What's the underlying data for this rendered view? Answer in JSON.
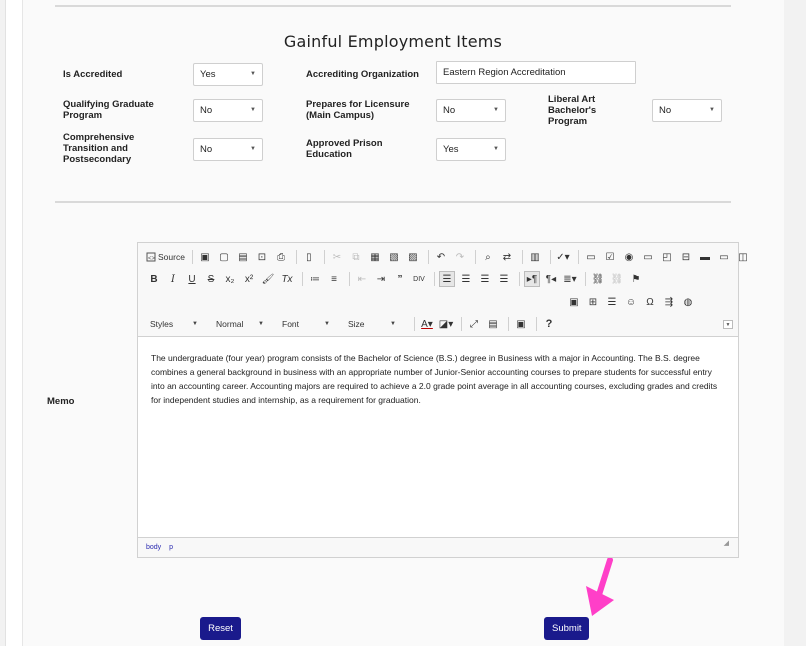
{
  "section": {
    "title": "Gainful Employment Items"
  },
  "fields": {
    "is_accredited": {
      "label": "Is Accredited",
      "value": "Yes"
    },
    "accrediting_org": {
      "label": "Accrediting Organization",
      "value": "Eastern Region Accreditation"
    },
    "qualifying_grad": {
      "label": "Qualifying Graduate Program",
      "value": "No"
    },
    "prepares_licensure": {
      "label": "Prepares for Licensure (Main Campus)",
      "value": "No"
    },
    "liberal_art": {
      "label": "Liberal Art Bachelor's Program",
      "value": "No"
    },
    "comprehensive": {
      "label": "Comprehensive Transition and Postsecondary",
      "value": "No"
    },
    "prison_edu": {
      "label": "Approved Prison Education",
      "value": "Yes"
    }
  },
  "memo": {
    "label": "Memo",
    "source_label": "Source",
    "combos": {
      "styles": "Styles",
      "format": "Normal",
      "font": "Font",
      "size": "Size"
    },
    "help": "?",
    "text": "The undergraduate (four year) program consists of the Bachelor of Science (B.S.) degree in Business with a major in Accounting. The B.S. degree combines a general background in business with an appropriate number of Junior-Senior accounting courses to prepare students for successful entry into an accounting career. Accounting majors are required to achieve a 2.0 grade point average in all accounting courses, excluding grades and credits for independent studies and internship, as a requirement for graduation.",
    "status_path": [
      "body",
      "p"
    ]
  },
  "buttons": {
    "reset": "Reset",
    "submit": "Submit"
  },
  "colors": {
    "button_bg": "#1a1a8c",
    "cursor": "#ff3fc8",
    "status_link": "#2a2ab0"
  }
}
